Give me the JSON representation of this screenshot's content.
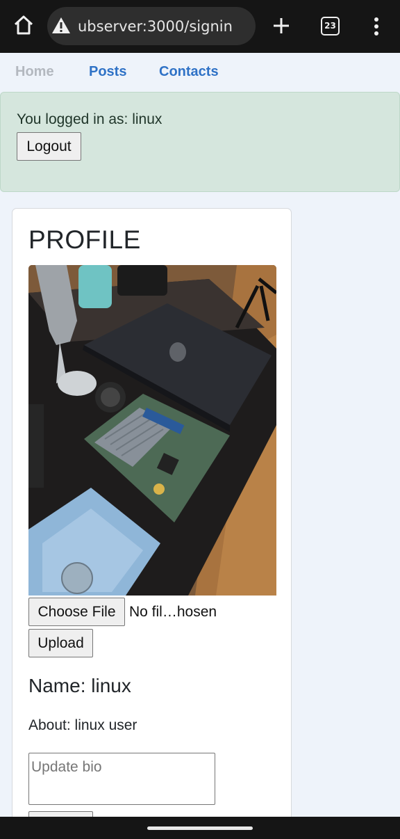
{
  "browser": {
    "url": "ubserver:3000/signin",
    "tab_count": "23",
    "icons": [
      "home-icon",
      "warning-icon",
      "plus-icon",
      "tabs-icon",
      "more-vert-icon"
    ]
  },
  "nav": {
    "home": "Home",
    "posts": "Posts",
    "contacts": "Contacts"
  },
  "alert": {
    "message": "You logged in as: linux",
    "logout_label": "Logout"
  },
  "profile": {
    "title": "PROFILE",
    "choose_file_label": "Choose File",
    "file_status": "No fil…hosen",
    "upload_label": "Upload",
    "name": "Name: linux",
    "about": "About: linux user",
    "bio_placeholder": "Update bio"
  },
  "colors": {
    "link": "#2f72c6",
    "link_disabled": "#b3b8bf",
    "alert_bg": "#d5e6dd",
    "page_bg": "#eef3fa"
  }
}
